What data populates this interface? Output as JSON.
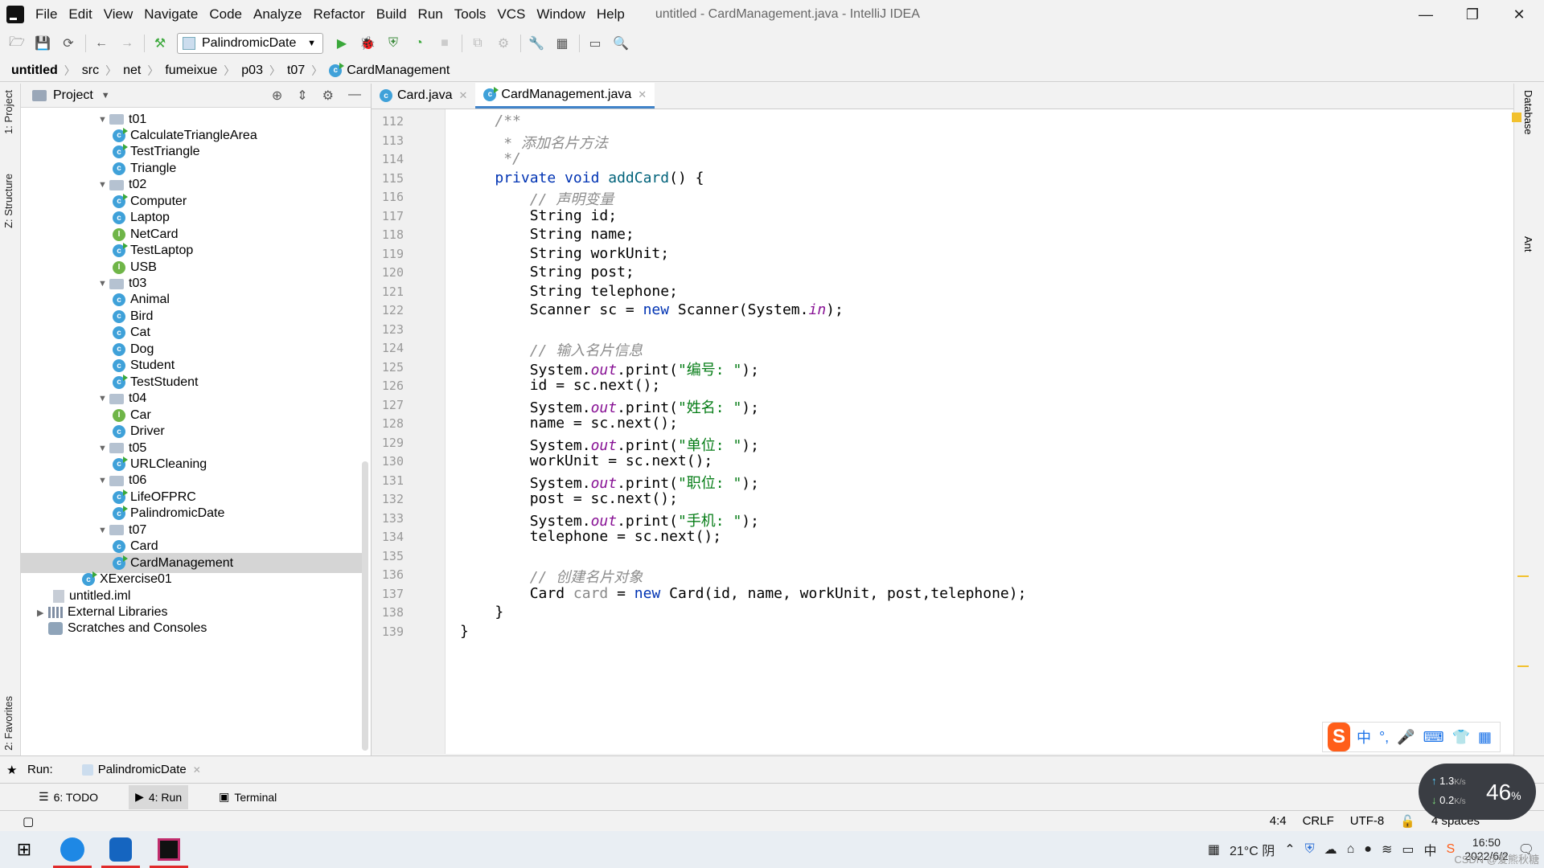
{
  "menu": {
    "items": [
      "File",
      "Edit",
      "View",
      "Navigate",
      "Code",
      "Analyze",
      "Refactor",
      "Build",
      "Run",
      "Tools",
      "VCS",
      "Window",
      "Help"
    ],
    "window_title": "untitled - CardManagement.java - IntelliJ IDEA"
  },
  "toolbar": {
    "run_config": "PalindromicDate"
  },
  "breadcrumb": [
    "untitled",
    "src",
    "net",
    "fumeixue",
    "p03",
    "t07",
    "CardManagement"
  ],
  "left_stripe": {
    "project": "1: Project",
    "structure": "Z: Structure",
    "favorites": "2: Favorites"
  },
  "right_stripe": {
    "database": "Database",
    "ant": "Ant"
  },
  "project_panel": {
    "title": "Project",
    "tree": [
      {
        "label": "t01",
        "kind": "folder",
        "level": 0,
        "expanded": true
      },
      {
        "label": "CalculateTriangleArea",
        "kind": "class-run",
        "level": 1
      },
      {
        "label": "TestTriangle",
        "kind": "class-run",
        "level": 1
      },
      {
        "label": "Triangle",
        "kind": "class",
        "level": 1
      },
      {
        "label": "t02",
        "kind": "folder",
        "level": 0,
        "expanded": true
      },
      {
        "label": "Computer",
        "kind": "class-run",
        "level": 1
      },
      {
        "label": "Laptop",
        "kind": "class",
        "level": 1
      },
      {
        "label": "NetCard",
        "kind": "interface",
        "level": 1
      },
      {
        "label": "TestLaptop",
        "kind": "class-run",
        "level": 1
      },
      {
        "label": "USB",
        "kind": "interface",
        "level": 1
      },
      {
        "label": "t03",
        "kind": "folder",
        "level": 0,
        "expanded": true
      },
      {
        "label": "Animal",
        "kind": "class",
        "level": 1
      },
      {
        "label": "Bird",
        "kind": "class",
        "level": 1
      },
      {
        "label": "Cat",
        "kind": "class",
        "level": 1
      },
      {
        "label": "Dog",
        "kind": "class",
        "level": 1
      },
      {
        "label": "Student",
        "kind": "class",
        "level": 1
      },
      {
        "label": "TestStudent",
        "kind": "class-run",
        "level": 1
      },
      {
        "label": "t04",
        "kind": "folder",
        "level": 0,
        "expanded": true
      },
      {
        "label": "Car",
        "kind": "interface",
        "level": 1
      },
      {
        "label": "Driver",
        "kind": "class",
        "level": 1
      },
      {
        "label": "t05",
        "kind": "folder",
        "level": 0,
        "expanded": true
      },
      {
        "label": "URLCleaning",
        "kind": "class-run",
        "level": 1
      },
      {
        "label": "t06",
        "kind": "folder",
        "level": 0,
        "expanded": true
      },
      {
        "label": "LifeOFPRC",
        "kind": "class-run",
        "level": 1
      },
      {
        "label": "PalindromicDate",
        "kind": "class-run",
        "level": 1
      },
      {
        "label": "t07",
        "kind": "folder",
        "level": 0,
        "expanded": true
      },
      {
        "label": "Card",
        "kind": "class",
        "level": 1
      },
      {
        "label": "CardManagement",
        "kind": "class-run",
        "level": 1,
        "selected": true
      },
      {
        "label": "XExercise01",
        "kind": "class-run",
        "level": -1
      },
      {
        "label": "untitled.iml",
        "kind": "iml",
        "level": -2
      },
      {
        "label": "External Libraries",
        "kind": "lib",
        "level": -3
      },
      {
        "label": "Scratches and Consoles",
        "kind": "scratch",
        "level": -3
      }
    ]
  },
  "editor": {
    "tabs": [
      {
        "label": "Card.java",
        "active": false
      },
      {
        "label": "CardManagement.java",
        "active": true
      }
    ],
    "lines": [
      {
        "n": "112",
        "html": "    <span class=\"cm\">/**</span>"
      },
      {
        "n": "113",
        "html": "     <span class=\"cm\">* 添加名片方法</span>"
      },
      {
        "n": "114",
        "html": "     <span class=\"cm\">*/</span>"
      },
      {
        "n": "115",
        "html": "    <span class=\"kw\">private void</span> <span class=\"fn\">addCard</span>() {"
      },
      {
        "n": "116",
        "html": "        <span class=\"cm\">// 声明变量</span>"
      },
      {
        "n": "117",
        "html": "        String id;"
      },
      {
        "n": "118",
        "html": "        String name;"
      },
      {
        "n": "119",
        "html": "        String workUnit;"
      },
      {
        "n": "120",
        "html": "        String post;"
      },
      {
        "n": "121",
        "html": "        String telephone;"
      },
      {
        "n": "122",
        "html": "        Scanner sc = <span class=\"kw\">new</span> Scanner(System.<span class=\"fld\">in</span>);"
      },
      {
        "n": "123",
        "html": ""
      },
      {
        "n": "124",
        "html": "        <span class=\"cm\">// 输入名片信息</span>"
      },
      {
        "n": "125",
        "html": "        System.<span class=\"fld\">out</span>.print(<span class=\"st\">\"编号: \"</span>);"
      },
      {
        "n": "126",
        "html": "        id = sc.next();"
      },
      {
        "n": "127",
        "html": "        System.<span class=\"fld\">out</span>.print(<span class=\"st\">\"姓名: \"</span>);"
      },
      {
        "n": "128",
        "html": "        name = sc.next();"
      },
      {
        "n": "129",
        "html": "        System.<span class=\"fld\">out</span>.print(<span class=\"st\">\"单位: \"</span>);"
      },
      {
        "n": "130",
        "html": "        workUnit = sc.next();"
      },
      {
        "n": "131",
        "html": "        System.<span class=\"fld\">out</span>.print(<span class=\"st\">\"职位: \"</span>);"
      },
      {
        "n": "132",
        "html": "        post = sc.next();"
      },
      {
        "n": "133",
        "html": "        System.<span class=\"fld\">out</span>.print(<span class=\"st\">\"手机: \"</span>);"
      },
      {
        "n": "134",
        "html": "        telephone = sc.next();"
      },
      {
        "n": "135",
        "html": ""
      },
      {
        "n": "136",
        "html": "        <span class=\"cm\">// 创建名片对象</span>"
      },
      {
        "n": "137",
        "html": "        Card <span class=\"var\">card</span> = <span class=\"kw\">new</span> Card(id, name, workUnit, post,telephone);"
      },
      {
        "n": "138",
        "html": "    }"
      },
      {
        "n": "139",
        "html": "}"
      }
    ]
  },
  "run_bar": {
    "label": "Run:",
    "tab": "PalindromicDate"
  },
  "bottom_tabs": [
    "6: TODO",
    "4: Run",
    "Terminal"
  ],
  "status": {
    "position": "4:4",
    "line_sep": "CRLF",
    "encoding": "UTF-8",
    "indent": "4 spaces"
  },
  "speed_widget": {
    "up": "1.3",
    "down": "0.2",
    "unit": "K/s",
    "percent": "46",
    "pct_sign": "%"
  },
  "ime": {
    "logo": "S",
    "mode": "中",
    "punct": "°,"
  },
  "taskbar": {
    "weather": "21°C 阴",
    "time": "16:50",
    "date": "2022/6/2",
    "lang": "中",
    "watermark": "CSDN @爱熊秋糖"
  }
}
